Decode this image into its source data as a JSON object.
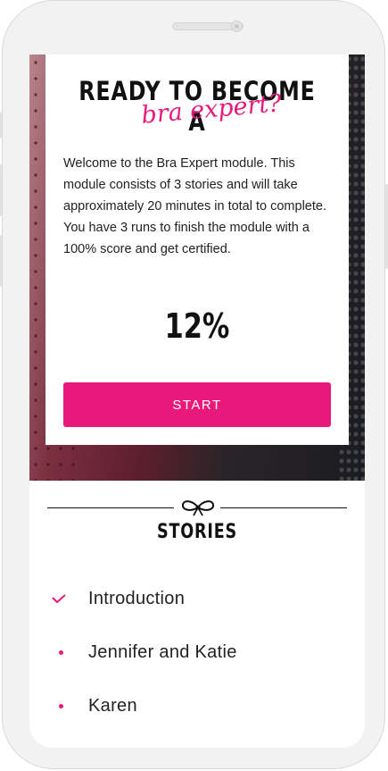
{
  "hero": {
    "title": "READY TO BECOME A",
    "title_script": "bra expert?",
    "description": "Welcome to the Bra Expert module. This module consists of 3 stories and will take approximately 20 minutes in total to complete. You have 3 runs to finish the module with a 100% score and get certified.",
    "progress_text": "12%",
    "start_label": "START"
  },
  "stories": {
    "heading": "STORIES",
    "items": [
      {
        "label": "Introduction",
        "status": "completed"
      },
      {
        "label": "Jennifer and Katie",
        "status": "pending"
      },
      {
        "label": "Karen",
        "status": "pending"
      }
    ]
  },
  "colors": {
    "accent": "#e8197b",
    "text": "#222222"
  },
  "icons": {
    "completed": "check-icon",
    "pending": "dot-icon",
    "divider": "bow-icon"
  }
}
